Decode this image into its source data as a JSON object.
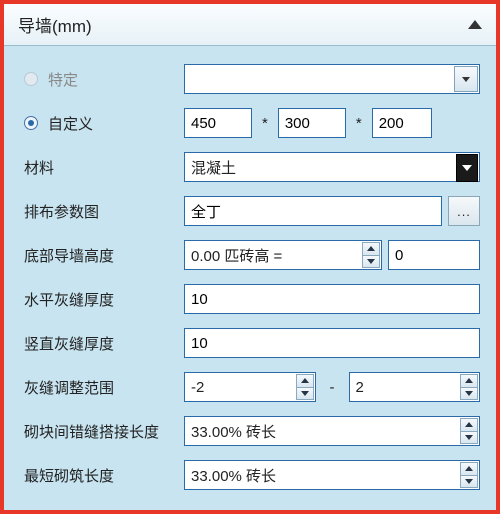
{
  "header": {
    "title": "导墙(mm)"
  },
  "mode": {
    "specific_label": "特定",
    "custom_label": "自定义",
    "specific_value": "",
    "custom_dim1": "450",
    "custom_dim2": "300",
    "custom_dim3": "200",
    "star": "*"
  },
  "rows": {
    "material_label": "材料",
    "material_value": "混凝土",
    "pattern_label": "排布参数图",
    "pattern_value": "全丁",
    "browse_label": "...",
    "bottom_height_label": "底部导墙高度",
    "bottom_height_spin": "0.00 匹砖高 =",
    "bottom_height_value": "0",
    "hjoint_label": "水平灰缝厚度",
    "hjoint_value": "10",
    "vjoint_label": "竖直灰缝厚度",
    "vjoint_value": "10",
    "adjust_label": "灰缝调整范围",
    "adjust_min": "-2",
    "adjust_sep": "-",
    "adjust_max": "2",
    "stagger_label": "砌块间错缝搭接长度",
    "stagger_value": "33.00% 砖长",
    "minlen_label": "最短砌筑长度",
    "minlen_value": "33.00% 砖长"
  }
}
